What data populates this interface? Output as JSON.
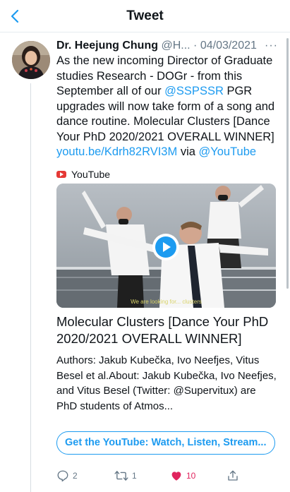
{
  "header": {
    "title": "Tweet"
  },
  "tweet": {
    "author_name": "Dr. Heejung Chung",
    "handle": "@H...",
    "date": "· 04/03/2021",
    "more": "···",
    "text_1": "As the new incoming Director of Graduate studies Research - DOGr - from this September all of our ",
    "mention_1": "@SSPSSR",
    "text_2": " PGR upgrades will now take form of a song and dance routine.  Molecular Clusters [Dance Your PhD 2020/2021 OVERALL WINNER] ",
    "link": "youtu.be/Kdrh82RVI3M",
    "text_3": " via ",
    "mention_2": "@YouTube"
  },
  "card": {
    "source": "YouTube",
    "caption": "We are looking for... clusters",
    "title": "Molecular Clusters [Dance Your PhD 2020/2021 OVERALL WINNER]",
    "description": "Authors: Jakub Kubečka, Ivo Neefjes, Vitus Besel et al.About: Jakub Kubečka, Ivo Neefjes, and Vitus Besel (Twitter: @Supervitux) are PhD students of Atmos...",
    "cta": "Get the YouTube: Watch, Listen, Stream..."
  },
  "actions": {
    "replies": "2",
    "retweets": "1",
    "likes": "10"
  },
  "colors": {
    "accent": "#1d9bf0",
    "like": "#e0245e",
    "muted": "#657786",
    "youtube": "#e53935"
  },
  "icons": [
    "back-arrow-icon",
    "more-icon",
    "youtube-icon",
    "play-icon",
    "reply-icon",
    "retweet-icon",
    "heart-icon",
    "share-icon"
  ]
}
